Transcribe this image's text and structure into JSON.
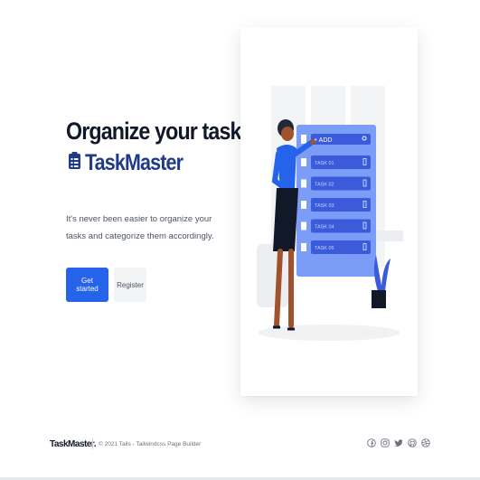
{
  "hero": {
    "title": "Organize your tasks",
    "brand": "TaskMaster",
    "description": "It's never been easier to organize your tasks and categorize them accordingly.",
    "primary_button": "Get started",
    "secondary_button": "Register"
  },
  "illustration": {
    "add_label": "+ ADD",
    "tasks": [
      "TASK 01",
      "TASK 02",
      "TASK 03",
      "TASK 04",
      "TASK 05"
    ]
  },
  "footer": {
    "logo": "TaskMaster.",
    "copyright": "© 2021 Tails - Tailwindcss Page Builder",
    "social_icons": [
      "facebook-icon",
      "instagram-icon",
      "twitter-icon",
      "github-icon",
      "dribbble-icon"
    ]
  },
  "colors": {
    "primary": "#2563eb",
    "brand": "#1f3a8a",
    "panel": "#7b9cf7"
  }
}
